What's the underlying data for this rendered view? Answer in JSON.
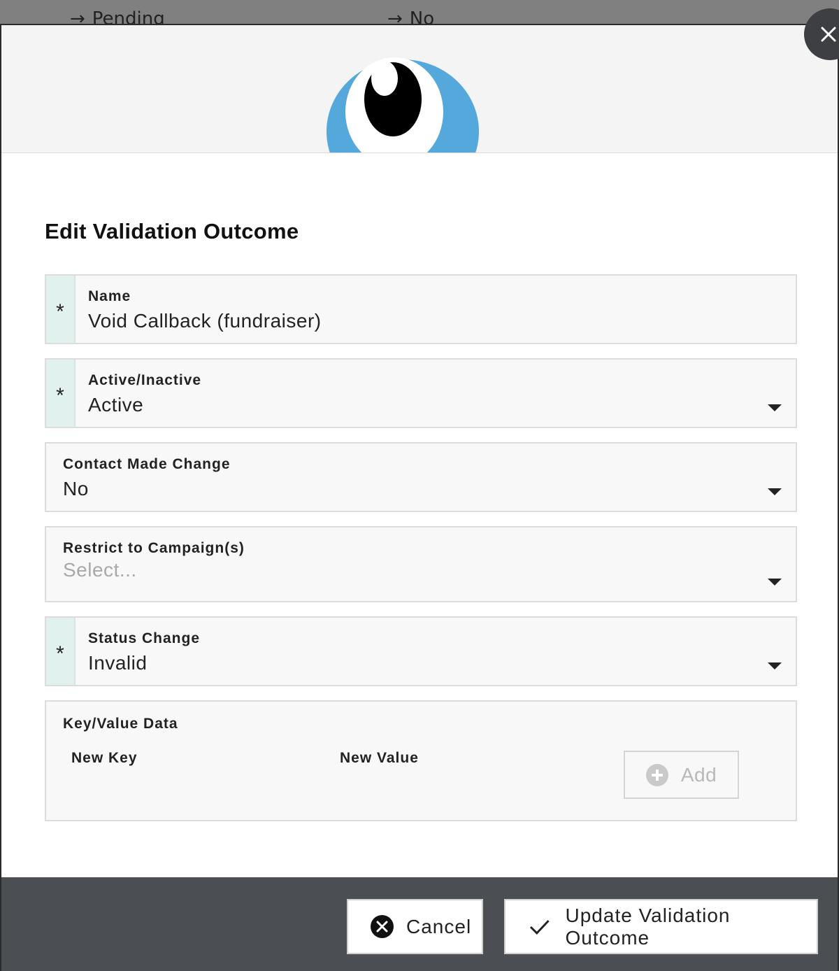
{
  "background": {
    "items": [
      {
        "arrow": "→",
        "text": "Pending"
      },
      {
        "arrow": "→",
        "text": "No"
      }
    ]
  },
  "modal": {
    "title": "Edit Validation Outcome",
    "close_icon": "close-icon",
    "logo": "eye-logo",
    "brand_color": "#55a8dc",
    "required_marker": "*"
  },
  "form": {
    "name": {
      "label": "Name",
      "value": "Void Callback (fundraiser)",
      "required": true
    },
    "active": {
      "label": "Active/Inactive",
      "value": "Active",
      "required": true
    },
    "contact_made": {
      "label": "Contact Made Change",
      "value": "No",
      "required": false
    },
    "campaigns": {
      "label": "Restrict to Campaign(s)",
      "placeholder": "Select...",
      "required": false
    },
    "status": {
      "label": "Status Change",
      "value": "Invalid",
      "required": true
    },
    "key_value": {
      "label": "Key/Value Data",
      "new_key_label": "New Key",
      "new_value_label": "New Value",
      "add_label": "Add"
    }
  },
  "footer": {
    "cancel_label": "Cancel",
    "update_label": "Update Validation Outcome"
  },
  "colors": {
    "required_bg": "#e0f1ee",
    "footer_bg": "#4b4e53",
    "overlay": "#808080"
  }
}
